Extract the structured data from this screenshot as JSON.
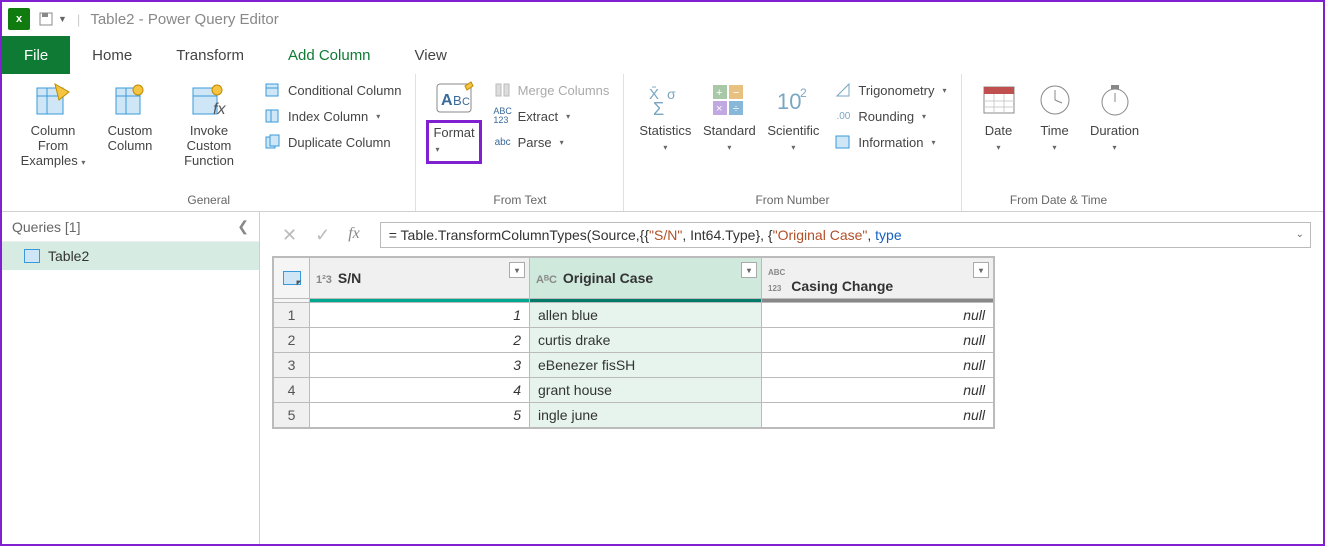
{
  "title": "Table2 - Power Query Editor",
  "tabs": {
    "file": "File",
    "home": "Home",
    "transform": "Transform",
    "addcolumn": "Add Column",
    "view": "View",
    "active": "Add Column"
  },
  "ribbon": {
    "general": {
      "label": "General",
      "column_from_examples": "Column From Examples",
      "custom_column": "Custom Column",
      "invoke_custom_function": "Invoke Custom Function",
      "conditional_column": "Conditional Column",
      "index_column": "Index Column",
      "duplicate_column": "Duplicate Column"
    },
    "from_text": {
      "label": "From Text",
      "format": "Format",
      "merge_columns": "Merge Columns",
      "extract": "Extract",
      "parse": "Parse"
    },
    "from_number": {
      "label": "From Number",
      "statistics": "Statistics",
      "standard": "Standard",
      "scientific": "Scientific",
      "trigonometry": "Trigonometry",
      "rounding": "Rounding",
      "information": "Information"
    },
    "from_datetime": {
      "label": "From Date & Time",
      "date": "Date",
      "time": "Time",
      "duration": "Duration"
    }
  },
  "queries": {
    "header": "Queries [1]",
    "items": [
      "Table2"
    ]
  },
  "formula": {
    "prefix": "= ",
    "fn": "Table.TransformColumnTypes",
    "open": "(Source,{{",
    "str1": "\"S/N\"",
    "mid1": ", Int64.Type}, {",
    "str2": "\"Original Case\"",
    "mid2": ", ",
    "type": "type"
  },
  "grid": {
    "columns": [
      {
        "key": "sn",
        "label": "S/N",
        "type_icon": "1²3"
      },
      {
        "key": "orig",
        "label": "Original Case",
        "type_icon": "AᴮC",
        "selected": true
      },
      {
        "key": "casing",
        "label": "Casing Change",
        "type_icon": "ABC123"
      }
    ],
    "rows": [
      {
        "idx": 1,
        "sn": 1,
        "orig": "allen blue",
        "casing": "null"
      },
      {
        "idx": 2,
        "sn": 2,
        "orig": "curtis drake",
        "casing": "null"
      },
      {
        "idx": 3,
        "sn": 3,
        "orig": "eBenezer fisSH",
        "casing": "null"
      },
      {
        "idx": 4,
        "sn": 4,
        "orig": "grant house",
        "casing": "null"
      },
      {
        "idx": 5,
        "sn": 5,
        "orig": "ingle june",
        "casing": "null"
      }
    ]
  }
}
